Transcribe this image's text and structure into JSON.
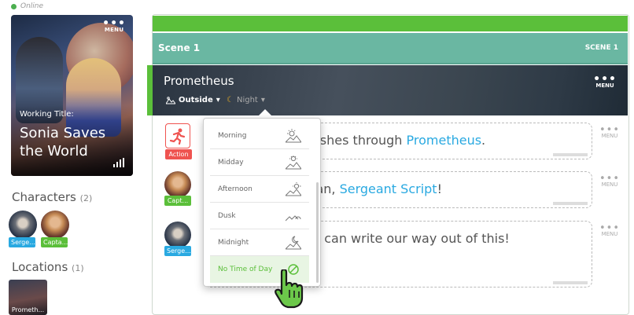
{
  "status": {
    "label": "Online"
  },
  "cover": {
    "menu_label": "MENU",
    "working_title_label": "Working Title:",
    "story_title": "Sonia Saves the World"
  },
  "characters": {
    "heading": "Characters",
    "count": "(2)",
    "items": [
      {
        "name": "Serge...",
        "color": "#29a9e1"
      },
      {
        "name": "Capta...",
        "color": "#5bbf3a"
      }
    ]
  },
  "locations": {
    "heading": "Locations",
    "count": "(1)",
    "items": [
      {
        "name": "Prometh..."
      }
    ]
  },
  "scene": {
    "title": "Scene 1",
    "number_label": "SCENE 1"
  },
  "heading": {
    "location": "Prometheus",
    "setting": "Outside",
    "time_of_day": "Night",
    "menu_label": "MENU"
  },
  "lines": [
    {
      "tag": "Action",
      "tag_color": "#ef5350",
      "text_before": "ashes through ",
      "character": "Prometheus",
      "text_after": "."
    },
    {
      "tag": "Capt...",
      "tag_color": "#5bbf3a",
      "text_before": "lan, ",
      "character": "Sergeant Script",
      "text_after": "!"
    },
    {
      "tag": "Serge...",
      "tag_color": "#29a9e1",
      "text_before": "u can write our way out of this!",
      "character": "",
      "text_after": ""
    }
  ],
  "line_menu_label": "MENU",
  "time_of_day_menu": {
    "options": [
      {
        "label": "Morning",
        "icon": "sunrise-icon"
      },
      {
        "label": "Midday",
        "icon": "sun-high-icon"
      },
      {
        "label": "Afternoon",
        "icon": "sun-low-icon"
      },
      {
        "label": "Dusk",
        "icon": "sunset-icon"
      },
      {
        "label": "Midnight",
        "icon": "moon-icon"
      },
      {
        "label": "No Time of Day",
        "icon": "no-time-icon"
      }
    ],
    "selected": "No Time of Day"
  },
  "colors": {
    "accent_green": "#5bbf3a",
    "scene_teal": "#6ab7a2",
    "character_blue": "#29a9e1",
    "action_red": "#ef5350"
  }
}
